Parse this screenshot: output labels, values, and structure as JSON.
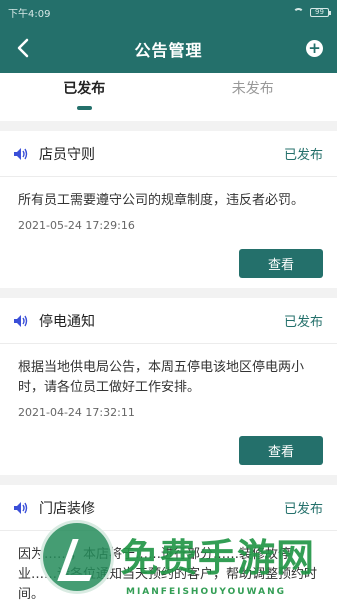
{
  "status_bar": {
    "time": "下午4:09",
    "battery": "99"
  },
  "header": {
    "title": "公告管理"
  },
  "tabs": [
    {
      "label": "已发布",
      "active": true
    },
    {
      "label": "未发布",
      "active": false
    }
  ],
  "announcements": [
    {
      "title": "店员守则",
      "status": "已发布",
      "content": "所有员工需要遵守公司的规章制度，违反者必罚。",
      "time": "2021-05-24 17:29:16",
      "button": "查看"
    },
    {
      "title": "停电通知",
      "status": "已发布",
      "content": "根据当地供电局公告，本周五停电该地区停电两小时，请各位员工做好工作安排。",
      "time": "2021-04-24 17:32:11",
      "button": "查看"
    },
    {
      "title": "门店装修",
      "status": "已发布",
      "content": "因为……，本店将于……进行部分……装修故停业……请各位通知当天预约的客户，帮助调整预约时间。"
    }
  ],
  "watermark": {
    "text": "免费手游网",
    "sub": "MIANFEISHOUYOUWANG"
  },
  "colors": {
    "brand": "#24706b"
  }
}
